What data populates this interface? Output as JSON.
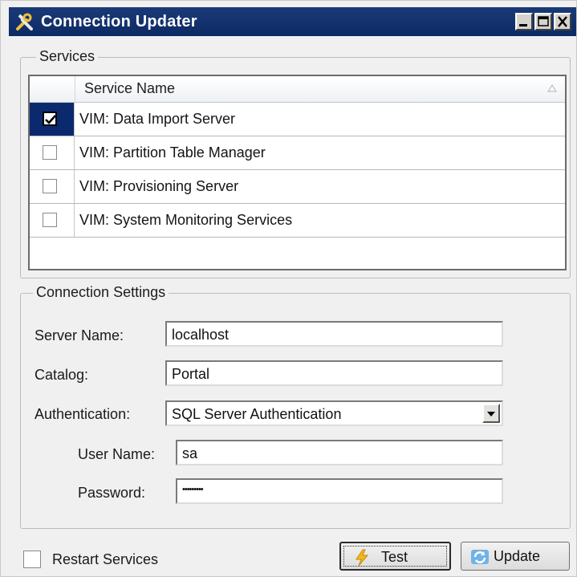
{
  "window": {
    "title": "Connection Updater",
    "controls": [
      "minimize-icon",
      "maximize-icon",
      "close-icon"
    ]
  },
  "services": {
    "group_label": "Services",
    "column_header": "Service Name",
    "rows": [
      {
        "label": "VIM: Data Import Server",
        "checked": true,
        "selected": true
      },
      {
        "label": "VIM: Partition Table Manager",
        "checked": false,
        "selected": false
      },
      {
        "label": "VIM: Provisioning Server",
        "checked": false,
        "selected": false
      },
      {
        "label": "VIM: System Monitoring Services",
        "checked": false,
        "selected": false
      }
    ]
  },
  "connection": {
    "group_label": "Connection Settings",
    "server_name_label": "Server Name:",
    "server_name_value": "localhost",
    "catalog_label": "Catalog:",
    "catalog_value": "Portal",
    "authentication_label": "Authentication:",
    "authentication_value": "SQL Server Authentication",
    "username_label": "User Name:",
    "username_value": "sa",
    "password_label": "Password:",
    "password_value": "•••••••••"
  },
  "footer": {
    "restart_label": "Restart Services",
    "restart_checked": false,
    "test_label": "Test",
    "update_label": "Update"
  },
  "colors": {
    "titlebar": "#0d2a63",
    "selection": "#0b2a6e",
    "window_bg": "#f0f0f0"
  }
}
